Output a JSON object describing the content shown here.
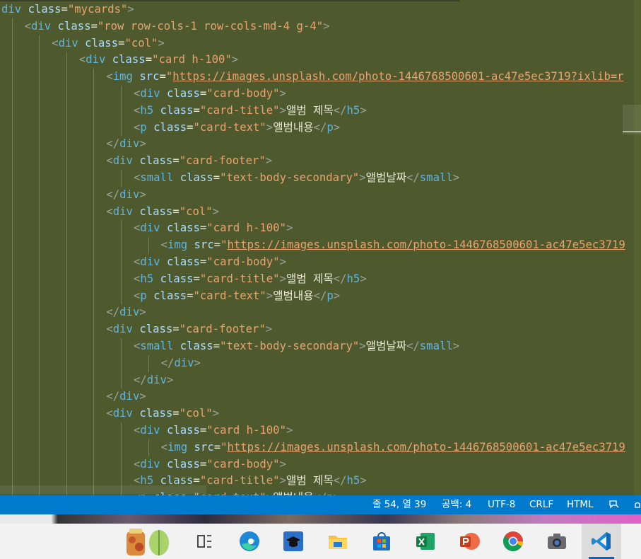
{
  "editor": {
    "theme": {
      "background": "#4e5a2e",
      "tag": "#5fb4e0",
      "attr": "#a9dcff",
      "string": "#e9a36e",
      "text": "#ece9d8"
    },
    "lines": [
      {
        "indent": 0,
        "frag": "div",
        "tokens": [
          [
            "tag",
            "div"
          ],
          [
            "sp",
            " "
          ],
          [
            "attr",
            "class"
          ],
          [
            "eq",
            "="
          ],
          [
            "str",
            "\"mycards\""
          ],
          [
            "punc",
            ">"
          ]
        ]
      },
      {
        "indent": 1,
        "tokens": [
          [
            "punc",
            "<"
          ],
          [
            "tag",
            "div"
          ],
          [
            "sp",
            " "
          ],
          [
            "attr",
            "class"
          ],
          [
            "eq",
            "="
          ],
          [
            "str",
            "\"row row-cols-1 row-cols-md-4 g-4\""
          ],
          [
            "punc",
            ">"
          ]
        ]
      },
      {
        "indent": 2,
        "tokens": [
          [
            "punc",
            "<"
          ],
          [
            "tag",
            "div"
          ],
          [
            "sp",
            " "
          ],
          [
            "attr",
            "class"
          ],
          [
            "eq",
            "="
          ],
          [
            "str",
            "\"col\""
          ],
          [
            "punc",
            ">"
          ]
        ]
      },
      {
        "indent": 3,
        "tokens": [
          [
            "punc",
            "<"
          ],
          [
            "tag",
            "div"
          ],
          [
            "sp",
            " "
          ],
          [
            "attr",
            "class"
          ],
          [
            "eq",
            "="
          ],
          [
            "str",
            "\"card h-100\""
          ],
          [
            "punc",
            ">"
          ]
        ]
      },
      {
        "indent": 4,
        "tokens": [
          [
            "punc",
            "<"
          ],
          [
            "tag",
            "img"
          ],
          [
            "sp",
            " "
          ],
          [
            "attr",
            "src"
          ],
          [
            "eq",
            "="
          ],
          [
            "str",
            "\""
          ],
          [
            "url",
            "https://images.unsplash.com/photo-1446768500601-ac47e5ec3719?ixlib=r"
          ]
        ]
      },
      {
        "indent": 5,
        "tokens": [
          [
            "punc",
            "<"
          ],
          [
            "tag",
            "div"
          ],
          [
            "sp",
            " "
          ],
          [
            "attr",
            "class"
          ],
          [
            "eq",
            "="
          ],
          [
            "str",
            "\"card-body\""
          ],
          [
            "punc",
            ">"
          ]
        ]
      },
      {
        "indent": 5,
        "tokens": [
          [
            "punc",
            "<"
          ],
          [
            "tag",
            "h5"
          ],
          [
            "sp",
            " "
          ],
          [
            "attr",
            "class"
          ],
          [
            "eq",
            "="
          ],
          [
            "str",
            "\"card-title\""
          ],
          [
            "punc",
            ">"
          ],
          [
            "text",
            "앨범 제목"
          ],
          [
            "punc",
            "</"
          ],
          [
            "tag",
            "h5"
          ],
          [
            "punc",
            ">"
          ]
        ]
      },
      {
        "indent": 5,
        "tokens": [
          [
            "punc",
            "<"
          ],
          [
            "tag",
            "p"
          ],
          [
            "sp",
            " "
          ],
          [
            "attr",
            "class"
          ],
          [
            "eq",
            "="
          ],
          [
            "str",
            "\"card-text\""
          ],
          [
            "punc",
            ">"
          ],
          [
            "text",
            "앨범내용"
          ],
          [
            "punc",
            "</"
          ],
          [
            "tag",
            "p"
          ],
          [
            "punc",
            ">"
          ]
        ]
      },
      {
        "indent": 4,
        "tokens": [
          [
            "punc",
            "</"
          ],
          [
            "tag",
            "div"
          ],
          [
            "punc",
            ">"
          ]
        ]
      },
      {
        "indent": 4,
        "tokens": [
          [
            "punc",
            "<"
          ],
          [
            "tag",
            "div"
          ],
          [
            "sp",
            " "
          ],
          [
            "attr",
            "class"
          ],
          [
            "eq",
            "="
          ],
          [
            "str",
            "\"card-footer\""
          ],
          [
            "punc",
            ">"
          ]
        ]
      },
      {
        "indent": 5,
        "tokens": [
          [
            "punc",
            "<"
          ],
          [
            "tag",
            "small"
          ],
          [
            "sp",
            " "
          ],
          [
            "attr",
            "class"
          ],
          [
            "eq",
            "="
          ],
          [
            "str",
            "\"text-body-secondary\""
          ],
          [
            "punc",
            ">"
          ],
          [
            "text",
            "앨범날짜"
          ],
          [
            "punc",
            "</"
          ],
          [
            "tag",
            "small"
          ],
          [
            "punc",
            ">"
          ]
        ]
      },
      {
        "indent": 4,
        "tokens": [
          [
            "punc",
            "</"
          ],
          [
            "tag",
            "div"
          ],
          [
            "punc",
            ">"
          ]
        ]
      },
      {
        "indent": 4,
        "tokens": [
          [
            "punc",
            "<"
          ],
          [
            "tag",
            "div"
          ],
          [
            "sp",
            " "
          ],
          [
            "attr",
            "class"
          ],
          [
            "eq",
            "="
          ],
          [
            "str",
            "\"col\""
          ],
          [
            "punc",
            ">"
          ]
        ]
      },
      {
        "indent": 5,
        "tokens": [
          [
            "punc",
            "<"
          ],
          [
            "tag",
            "div"
          ],
          [
            "sp",
            " "
          ],
          [
            "attr",
            "class"
          ],
          [
            "eq",
            "="
          ],
          [
            "str",
            "\"card h-100\""
          ],
          [
            "punc",
            ">"
          ]
        ]
      },
      {
        "indent": 6,
        "tokens": [
          [
            "punc",
            "<"
          ],
          [
            "tag",
            "img"
          ],
          [
            "sp",
            " "
          ],
          [
            "attr",
            "src"
          ],
          [
            "eq",
            "="
          ],
          [
            "str",
            "\""
          ],
          [
            "url",
            "https://images.unsplash.com/photo-1446768500601-ac47e5ec3719"
          ]
        ]
      },
      {
        "indent": 5,
        "tokens": [
          [
            "punc",
            "<"
          ],
          [
            "tag",
            "div"
          ],
          [
            "sp",
            " "
          ],
          [
            "attr",
            "class"
          ],
          [
            "eq",
            "="
          ],
          [
            "str",
            "\"card-body\""
          ],
          [
            "punc",
            ">"
          ]
        ]
      },
      {
        "indent": 5,
        "tokens": [
          [
            "punc",
            "<"
          ],
          [
            "tag",
            "h5"
          ],
          [
            "sp",
            " "
          ],
          [
            "attr",
            "class"
          ],
          [
            "eq",
            "="
          ],
          [
            "str",
            "\"card-title\""
          ],
          [
            "punc",
            ">"
          ],
          [
            "text",
            "앨범 제목"
          ],
          [
            "punc",
            "</"
          ],
          [
            "tag",
            "h5"
          ],
          [
            "punc",
            ">"
          ]
        ]
      },
      {
        "indent": 5,
        "tokens": [
          [
            "punc",
            "<"
          ],
          [
            "tag",
            "p"
          ],
          [
            "sp",
            " "
          ],
          [
            "attr",
            "class"
          ],
          [
            "eq",
            "="
          ],
          [
            "str",
            "\"card-text\""
          ],
          [
            "punc",
            ">"
          ],
          [
            "text",
            "앨범내용"
          ],
          [
            "punc",
            "</"
          ],
          [
            "tag",
            "p"
          ],
          [
            "punc",
            ">"
          ]
        ]
      },
      {
        "indent": 4,
        "tokens": [
          [
            "punc",
            "</"
          ],
          [
            "tag",
            "div"
          ],
          [
            "punc",
            ">"
          ]
        ]
      },
      {
        "indent": 4,
        "tokens": [
          [
            "punc",
            "<"
          ],
          [
            "tag",
            "div"
          ],
          [
            "sp",
            " "
          ],
          [
            "attr",
            "class"
          ],
          [
            "eq",
            "="
          ],
          [
            "str",
            "\"card-footer\""
          ],
          [
            "punc",
            ">"
          ]
        ]
      },
      {
        "indent": 5,
        "tokens": [
          [
            "punc",
            "<"
          ],
          [
            "tag",
            "small"
          ],
          [
            "sp",
            " "
          ],
          [
            "attr",
            "class"
          ],
          [
            "eq",
            "="
          ],
          [
            "str",
            "\"text-body-secondary\""
          ],
          [
            "punc",
            ">"
          ],
          [
            "text",
            "앨범날짜"
          ],
          [
            "punc",
            "</"
          ],
          [
            "tag",
            "small"
          ],
          [
            "punc",
            ">"
          ]
        ]
      },
      {
        "indent": 6,
        "tokens": [
          [
            "punc",
            "</"
          ],
          [
            "tag",
            "div"
          ],
          [
            "punc",
            ">"
          ]
        ]
      },
      {
        "indent": 5,
        "tokens": [
          [
            "punc",
            "</"
          ],
          [
            "tag",
            "div"
          ],
          [
            "punc",
            ">"
          ]
        ]
      },
      {
        "indent": 4,
        "tokens": [
          [
            "punc",
            "</"
          ],
          [
            "tag",
            "div"
          ],
          [
            "punc",
            ">"
          ]
        ]
      },
      {
        "indent": 4,
        "tokens": [
          [
            "punc",
            "<"
          ],
          [
            "tag",
            "div"
          ],
          [
            "sp",
            " "
          ],
          [
            "attr",
            "class"
          ],
          [
            "eq",
            "="
          ],
          [
            "str",
            "\"col\""
          ],
          [
            "punc",
            ">"
          ]
        ]
      },
      {
        "indent": 5,
        "tokens": [
          [
            "punc",
            "<"
          ],
          [
            "tag",
            "div"
          ],
          [
            "sp",
            " "
          ],
          [
            "attr",
            "class"
          ],
          [
            "eq",
            "="
          ],
          [
            "str",
            "\"card h-100\""
          ],
          [
            "punc",
            ">"
          ]
        ]
      },
      {
        "indent": 6,
        "tokens": [
          [
            "punc",
            "<"
          ],
          [
            "tag",
            "img"
          ],
          [
            "sp",
            " "
          ],
          [
            "attr",
            "src"
          ],
          [
            "eq",
            "="
          ],
          [
            "str",
            "\""
          ],
          [
            "url",
            "https://images.unsplash.com/photo-1446768500601-ac47e5ec3719"
          ]
        ]
      },
      {
        "indent": 5,
        "tokens": [
          [
            "punc",
            "<"
          ],
          [
            "tag",
            "div"
          ],
          [
            "sp",
            " "
          ],
          [
            "attr",
            "class"
          ],
          [
            "eq",
            "="
          ],
          [
            "str",
            "\"card-body\""
          ],
          [
            "punc",
            ">"
          ]
        ]
      },
      {
        "indent": 5,
        "tokens": [
          [
            "punc",
            "<"
          ],
          [
            "tag",
            "h5"
          ],
          [
            "sp",
            " "
          ],
          [
            "attr",
            "class"
          ],
          [
            "eq",
            "="
          ],
          [
            "str",
            "\"card-title\""
          ],
          [
            "punc",
            ">"
          ],
          [
            "text",
            "앨범 제목"
          ],
          [
            "punc",
            "</"
          ],
          [
            "tag",
            "h5"
          ],
          [
            "punc",
            ">"
          ]
        ]
      },
      {
        "indent": 5,
        "tokens": [
          [
            "punc",
            "<"
          ],
          [
            "tag",
            "p"
          ],
          [
            "sp",
            " "
          ],
          [
            "attr",
            "class"
          ],
          [
            "eq",
            "="
          ],
          [
            "str",
            "\"card-text\""
          ],
          [
            "punc",
            ">"
          ],
          [
            "text",
            "앨범내용"
          ],
          [
            "punc",
            "</"
          ],
          [
            "tag",
            "p"
          ],
          [
            "punc",
            ">"
          ]
        ]
      }
    ]
  },
  "statusbar": {
    "position": "줄 54, 열 39",
    "indent": "공백: 4",
    "encoding": "UTF-8",
    "eol": "CRLF",
    "language": "HTML",
    "background": "#007acc"
  },
  "taskbar": {
    "icons": [
      "pickles-sticker-icon",
      "task-view-icon",
      "edge-icon",
      "graduation-cap-icon",
      "file-explorer-icon",
      "microsoft-store-icon",
      "excel-icon",
      "powerpoint-icon",
      "chrome-icon",
      "camera-icon",
      "vscode-icon"
    ],
    "active": "vscode-icon"
  }
}
